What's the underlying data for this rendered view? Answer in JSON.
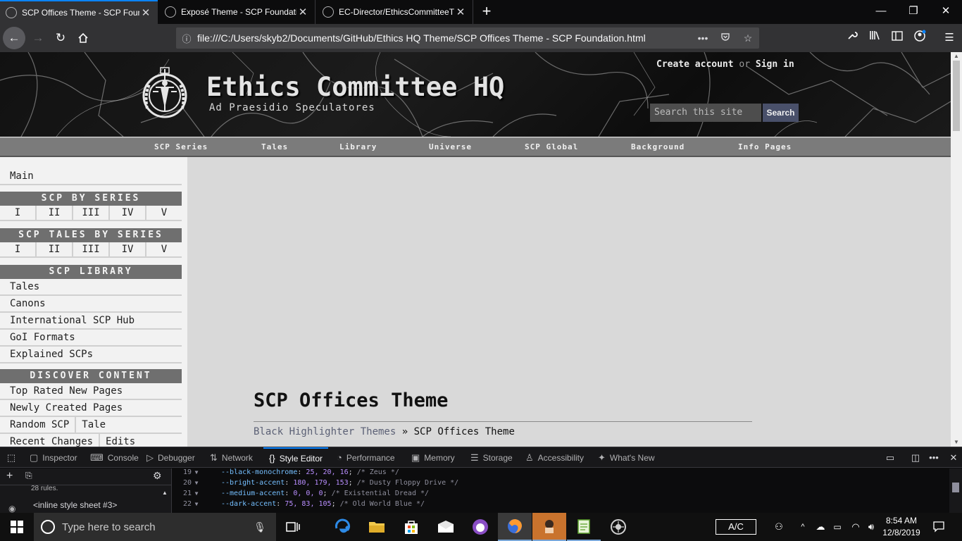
{
  "browser": {
    "tabs": [
      {
        "title": "SCP Offices Theme - SCP Foundation",
        "active": true
      },
      {
        "title": "Exposé Theme - SCP Foundation",
        "active": false
      },
      {
        "title": "EC-Director/EthicsCommitteeTheme",
        "active": false
      }
    ],
    "new_tab_label": "+",
    "url": "file:///C:/Users/skyb2/Documents/GitHub/Ethics HQ Theme/SCP Offices Theme - SCP Foundation.html",
    "window_controls": {
      "minimize": "—",
      "restore": "❐",
      "close": "✕"
    }
  },
  "site": {
    "title": "Ethics Committee HQ",
    "tagline": "Ad Praesidio Speculatores",
    "create_account": "Create account",
    "or": "or",
    "sign_in": "Sign in",
    "search_placeholder": "Search this site",
    "search_button": "Search",
    "topnav": [
      "SCP Series",
      "Tales",
      "Library",
      "Universe",
      "SCP Global",
      "Background",
      "Info Pages"
    ]
  },
  "sidebar": {
    "main": "Main",
    "scp_by_series": {
      "heading": "SCP BY SERIES",
      "items": [
        "I",
        "II",
        "III",
        "IV",
        "V"
      ]
    },
    "scp_tales_by_series": {
      "heading": "SCP TALES BY SERIES",
      "items": [
        "I",
        "II",
        "III",
        "IV",
        "V"
      ]
    },
    "scp_library": {
      "heading": "SCP LIBRARY",
      "items": [
        "Tales",
        "Canons",
        "International SCP Hub",
        "GoI Formats",
        "Explained SCPs"
      ]
    },
    "discover_content": {
      "heading": "DISCOVER CONTENT",
      "items": [
        "Top Rated New Pages",
        "Newly Created Pages"
      ],
      "random_scp": "Random SCP",
      "tale": "Tale",
      "recent_changes": "Recent Changes",
      "edits": "Edits"
    }
  },
  "page": {
    "title": "SCP Offices Theme",
    "breadcrumb_link": "Black Highlighter Themes",
    "breadcrumb_sep": "»",
    "breadcrumb_current": "SCP Offices Theme"
  },
  "devtools": {
    "tabs": [
      {
        "label": "Inspector",
        "icon": "inspector-icon"
      },
      {
        "label": "Console",
        "icon": "console-icon"
      },
      {
        "label": "Debugger",
        "icon": "debugger-icon"
      },
      {
        "label": "Network",
        "icon": "network-icon"
      },
      {
        "label": "Style Editor",
        "icon": "style-editor-icon"
      },
      {
        "label": "Performance",
        "icon": "performance-icon"
      },
      {
        "label": "Memory",
        "icon": "memory-icon"
      },
      {
        "label": "Storage",
        "icon": "storage-icon"
      },
      {
        "label": "Accessibility",
        "icon": "accessibility-icon"
      },
      {
        "label": "What's New",
        "icon": "whats-new-icon"
      }
    ],
    "active_tab": "Style Editor",
    "rules_count": "28 rules.",
    "sheet_name": "<inline style sheet #3>",
    "code": [
      {
        "line": "19",
        "prop": "--black-monochrome",
        "value": "25, 20, 16",
        "comment": "/* Zeus */"
      },
      {
        "line": "20",
        "prop": "--bright-accent",
        "value": "180, 179, 153",
        "comment": "/* Dusty Floppy Drive */"
      },
      {
        "line": "21",
        "prop": "--medium-accent",
        "value": "0, 0, 0",
        "comment": "/* Existential Dread */"
      },
      {
        "line": "22",
        "prop": "--dark-accent",
        "value": "75, 83, 105",
        "comment": "/* Old World Blue */"
      }
    ]
  },
  "taskbar": {
    "search_placeholder": "Type here to search",
    "ac_label": "A/C",
    "time": "8:54 AM",
    "date": "12/8/2019"
  },
  "colors": {
    "accent_blue": "#0a84ff",
    "sidebar_heading_bg": "#6f6f6f",
    "topnav_bg": "#7b7b7b",
    "search_button_bg": "#49506a",
    "breadcrumb_link": "#5b6075"
  }
}
